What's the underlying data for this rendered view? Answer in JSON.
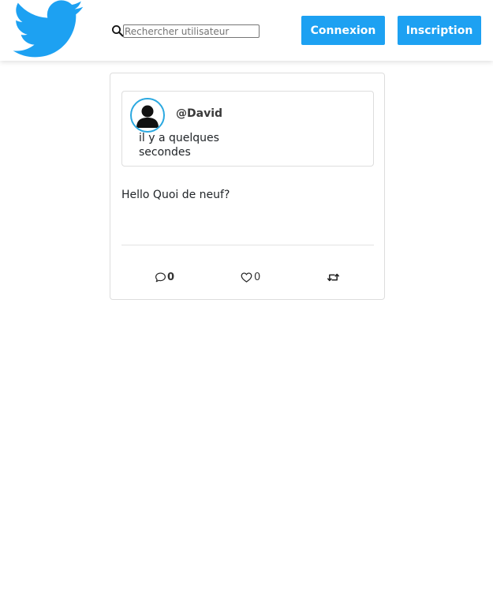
{
  "header": {
    "logo": "twitter-bird-icon",
    "search": {
      "icon": "search-icon",
      "placeholder": "Rechercher utilisateur",
      "value": ""
    },
    "login_label": "Connexion",
    "register_label": "Inscription"
  },
  "tweet": {
    "avatar_icon": "user-avatar-icon",
    "username": "@David",
    "timestamp": "il y a quelques secondes",
    "text": "Hello Quoi de neuf?",
    "actions": {
      "comment": {
        "icon": "comment-icon",
        "count": "0"
      },
      "like": {
        "icon": "heart-icon",
        "count": "0"
      },
      "retweet": {
        "icon": "retweet-icon"
      }
    }
  },
  "colors": {
    "brand": "#1da1f2",
    "avatar_border": "#2aa8e0",
    "card_border": "#dddddd"
  }
}
